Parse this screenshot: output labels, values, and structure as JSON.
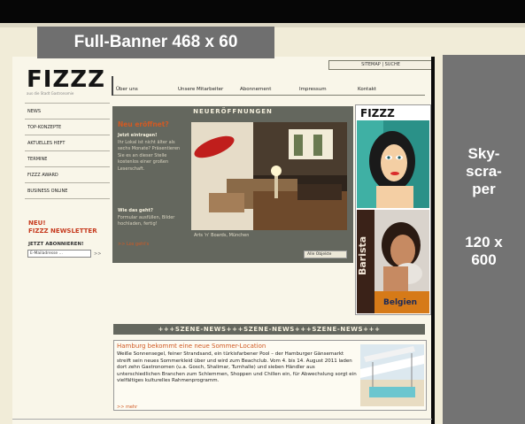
{
  "banner": {
    "label": "Full-Banner 468 x 60"
  },
  "skyscraper": {
    "label_lines": [
      "Sky-",
      "scra-",
      "per"
    ],
    "size_lines": [
      "120 x",
      "600"
    ]
  },
  "site": {
    "logo": "FIZZZ",
    "logo_sub": "aus die Stadt Gastronomie",
    "meta_links": "SITEMAP | SUCHE",
    "top_nav": [
      "Über uns",
      "Unsere Mitarbeiter",
      "Abonnement",
      "Impressum",
      "Kontakt"
    ],
    "side_nav": [
      "NEWS",
      "TOP-KONZEPTE",
      "AKTUELLES HEFT",
      "TERMINE",
      "FIZZZ AWARD",
      "BUSINESS ONLINE"
    ]
  },
  "newsletter": {
    "badge": "NEU!",
    "title": "FIZZZ NEWSLETTER",
    "subtitle": "JETZT ABONNIEREN!",
    "input_placeholder": "E-Mailadresse ...",
    "submit": ">>"
  },
  "feature": {
    "section_title": "NEUERÖFFNUNGEN",
    "headline": "Neu eröffnet?",
    "intro_lead": "Jetzt eintragen!",
    "intro_text": "Ihr Lokal ist nicht älter als sechs Monate? Präsentieren Sie es an dieser Stelle kostenlos einer großen Leserschaft.",
    "howto_lead": "Wie das geht?",
    "howto_text": "Formular ausfüllen, Bilder hochladen, fertig!",
    "link": ">> Los geht's",
    "caption": "Arts 'n' Boards, München",
    "select_label": "Alle Objekte"
  },
  "ads": {
    "mag1_title": "FIZZZ",
    "mag2_title": "Barista",
    "mag2_cover_text": "Belgien"
  },
  "news": {
    "bar_text": "+++SZENE-NEWS+++SZENE-NEWS+++SZENE-NEWS+++",
    "headline": "Hamburg bekommt eine neue Sommer-Location",
    "body": "Weiße Sonnensegel, feiner Strandsand, ein türkisfarbener Pool – der Hamburger Gänsemarkt streift sein neues Sommerkleid über und wird zum Beachclub. Vom 4. bis 14. August 2011 laden dort zehn Gastronomen (u.a. Gosch, Shalimar, Turnhalle) und sieben Händler aus unterschiedlichen Branchen zum Schlemmen, Shoppen und Chillen ein, für Abwechslung sorgt ein vielfältiges kulturelles Rahmenprogramm.",
    "more": ">> mehr"
  },
  "colors": {
    "accent": "#d05a24",
    "panel": "#64675e",
    "ad_placeholder": "#737373"
  }
}
